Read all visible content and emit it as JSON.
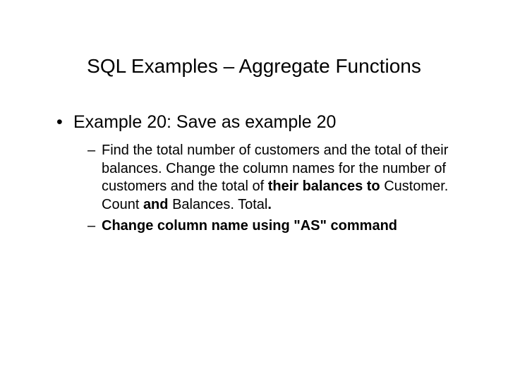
{
  "title": "SQL Examples – Aggregate Functions",
  "bullet1": {
    "marker": "•",
    "text": "Example 20: Save as example 20"
  },
  "sub1": {
    "marker": "–",
    "part1": "Find the total number of customers and the total of their balances. Change the column names for the number of customers and the total of ",
    "bold1": "their balances to ",
    "part2": "Customer. Count ",
    "bold2": "and ",
    "part3": "Balances. Total",
    "bold3": "."
  },
  "sub2": {
    "marker": "–",
    "text": "Change column name using \"AS\" command"
  }
}
